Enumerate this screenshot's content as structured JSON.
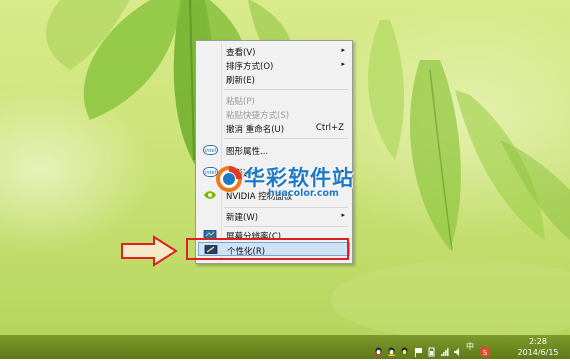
{
  "context_menu": {
    "items": [
      {
        "label": "查看(V)",
        "shortcut": "",
        "submenu": true,
        "disabled": false
      },
      {
        "label": "排序方式(O)",
        "shortcut": "",
        "submenu": true,
        "disabled": false
      },
      {
        "label": "刷新(E)",
        "shortcut": "",
        "submenu": false,
        "disabled": false
      },
      {
        "label": "粘贴(P)",
        "shortcut": "",
        "submenu": false,
        "disabled": true
      },
      {
        "label": "粘贴快捷方式(S)",
        "shortcut": "",
        "submenu": false,
        "disabled": true
      },
      {
        "label": "撤消 重命名(U)",
        "shortcut": "Ctrl+Z",
        "submenu": false,
        "disabled": false
      },
      {
        "label": "图形属性...",
        "shortcut": "",
        "submenu": false,
        "disabled": false
      },
      {
        "label": "图形选项",
        "shortcut": "",
        "submenu": true,
        "disabled": false
      },
      {
        "label": "NVIDIA 控制面板",
        "shortcut": "",
        "submenu": false,
        "disabled": false
      },
      {
        "label": "新建(W)",
        "shortcut": "",
        "submenu": true,
        "disabled": false
      },
      {
        "label": "屏幕分辨率(C)",
        "shortcut": "",
        "submenu": false,
        "disabled": false
      },
      {
        "label": "个性化(R)",
        "shortcut": "",
        "submenu": false,
        "disabled": false,
        "highlighted": true
      }
    ],
    "intel_icon_text": "intel",
    "submenu_arrow": "▸"
  },
  "watermark": {
    "cn": "华彩软件站",
    "en": "huacolor.com"
  },
  "taskbar": {
    "clock_time": "2:28",
    "clock_date": "2014/6/15",
    "ime_label": "中",
    "tray_icons": [
      "qq-icon",
      "qq-icon",
      "wechat-icon",
      "flag-icon",
      "battery-icon",
      "network-icon",
      "volume-icon",
      "ime-icon",
      "sogou-icon"
    ]
  },
  "colors": {
    "callout": "#e02020",
    "arrow_fill": "#f6e9c8",
    "menu_bg": "#f1f1f1",
    "highlight": "#cfe3f7",
    "watermark": "#1f79c6",
    "taskbar": "#6b8820"
  }
}
